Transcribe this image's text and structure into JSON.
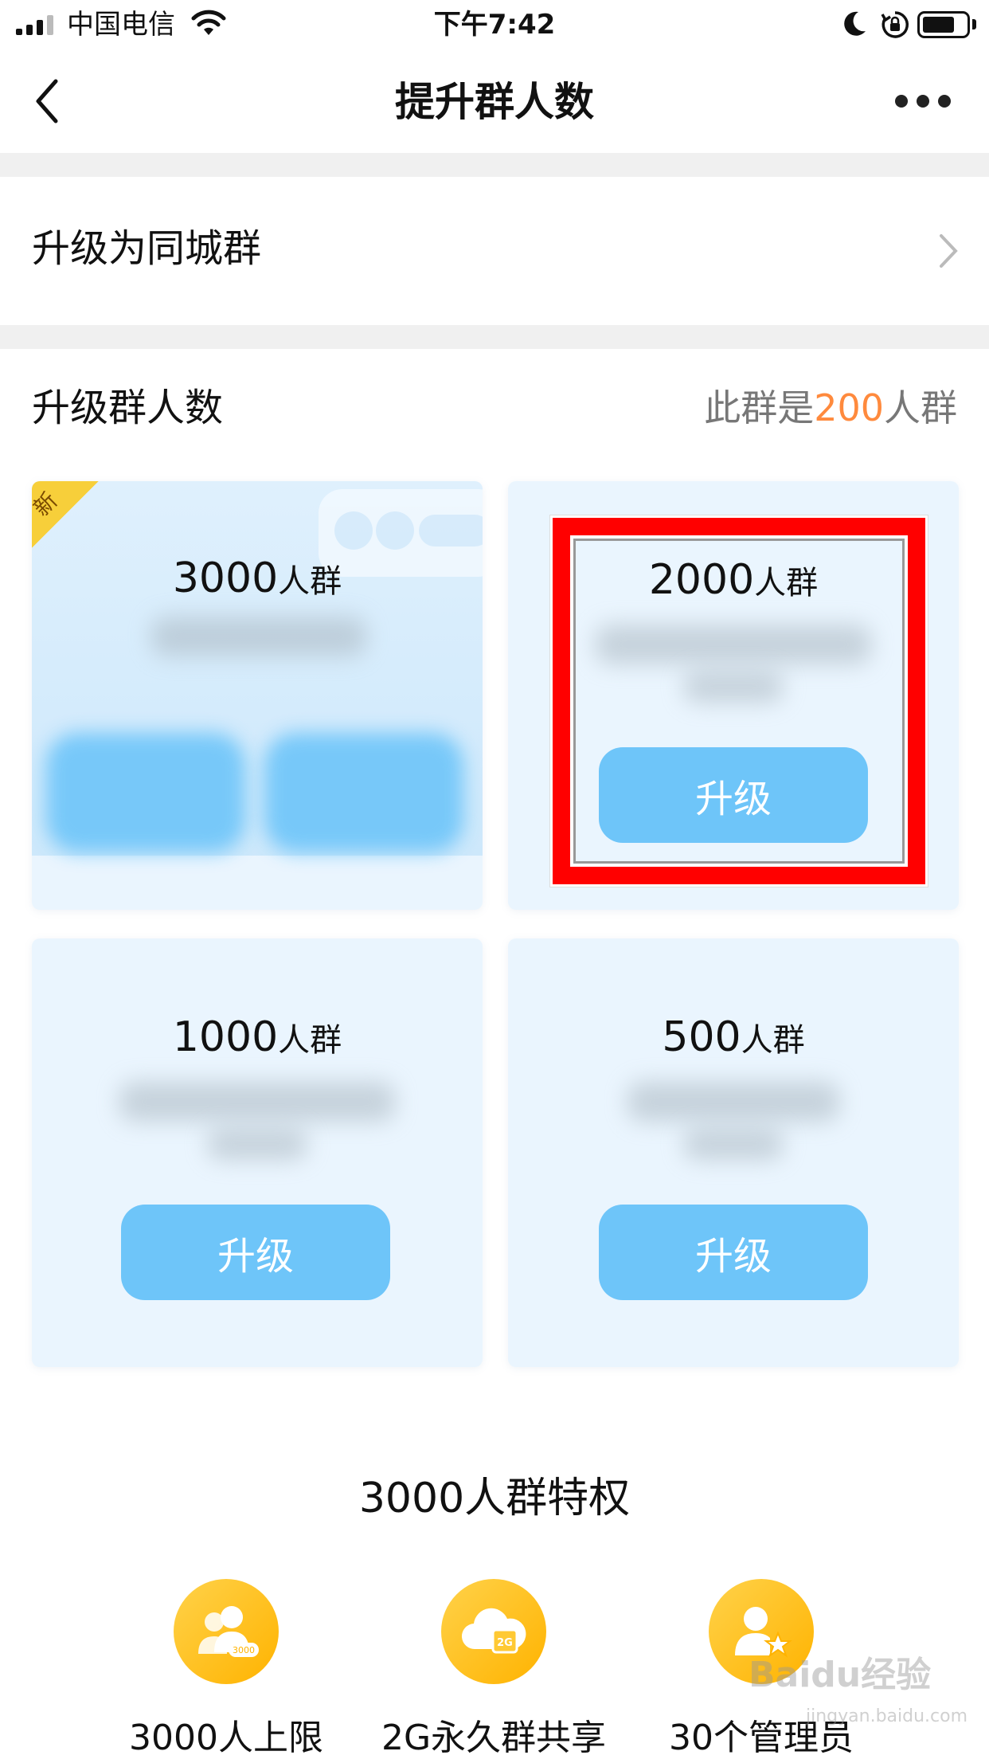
{
  "status_bar": {
    "carrier": "中国电信",
    "time": "下午7:42",
    "battery_level": 0.75
  },
  "nav": {
    "title": "提升群人数",
    "back_icon": "chevron-left-icon",
    "more_icon": "more-dots-icon"
  },
  "city_group_row": {
    "label": "升级为同城群",
    "icon": "chevron-right-icon"
  },
  "upgrade_section": {
    "title": "升级群人数",
    "info_prefix": "此群是",
    "info_count": "200",
    "info_suffix": "人群"
  },
  "cards": [
    {
      "count": "3000",
      "unit": "人群",
      "badge": "新",
      "button": ""
    },
    {
      "count": "2000",
      "unit": "人群",
      "badge": "",
      "button": "升级"
    },
    {
      "count": "1000",
      "unit": "人群",
      "badge": "",
      "button": "升级"
    },
    {
      "count": "500",
      "unit": "人群",
      "badge": "",
      "button": "升级"
    }
  ],
  "privileges": {
    "title": "3000人群特权",
    "items": [
      {
        "label": "3000人上限",
        "icon": "group-members-icon",
        "icon_text": "3000"
      },
      {
        "label": "2G永久群共享",
        "icon": "cloud-storage-icon",
        "icon_text": "2G"
      },
      {
        "label": "30个管理员",
        "icon": "admin-star-icon",
        "icon_text": ""
      }
    ]
  },
  "colors": {
    "accent_blue": "#6ec5f9",
    "card_bg": "#eaf5fe",
    "highlight_orange": "#ff8a3d",
    "annotation_red": "#ff0000",
    "privilege_gold": "#ffb300"
  },
  "watermark": {
    "text": "Baidu经验",
    "sub": "jingyan.baidu.com"
  }
}
